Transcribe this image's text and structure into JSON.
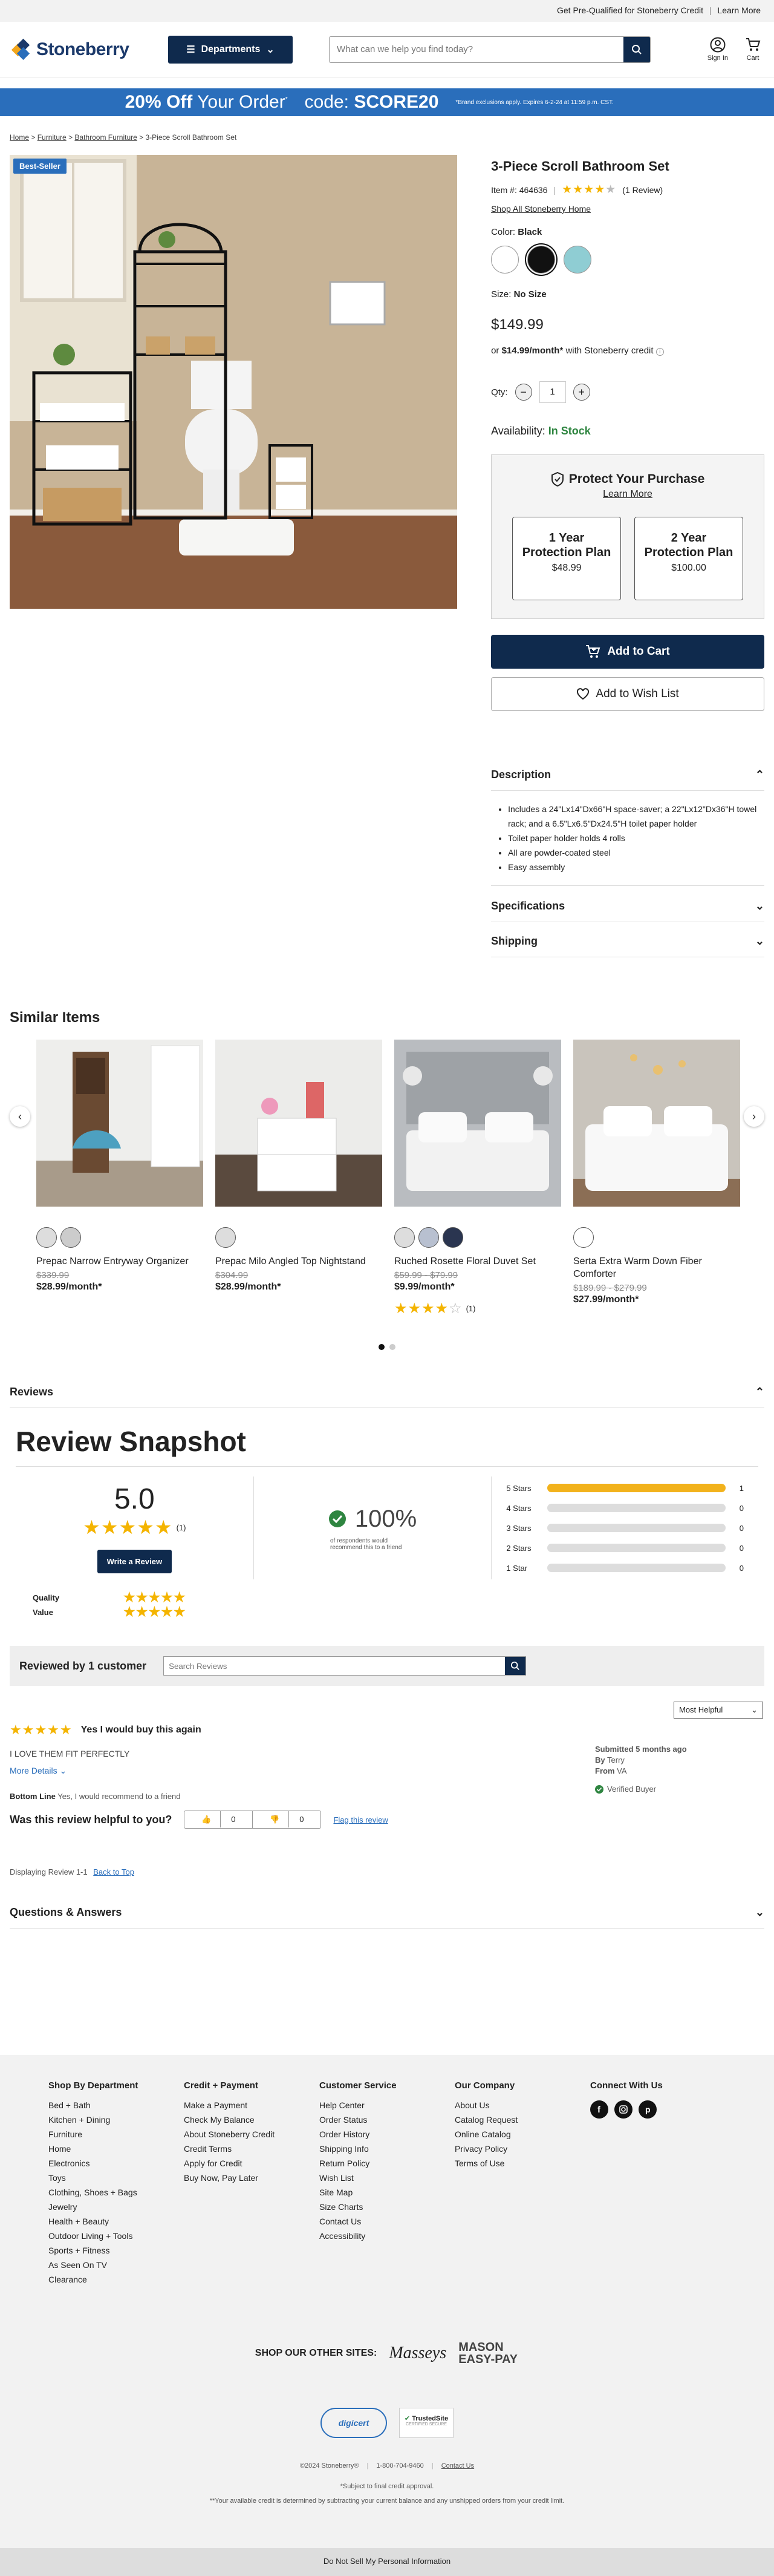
{
  "topbar": {
    "prequal": "Get Pre-Qualified for Stoneberry Credit",
    "sep": "|",
    "learn_more": "Learn More"
  },
  "header": {
    "logo_text": "Stoneberry",
    "departments_label": "Departments",
    "search_placeholder": "What can we help you find today?",
    "signin_label": "Sign In",
    "cart_label": "Cart"
  },
  "promo": {
    "headline_strong": "20% Off",
    "headline_rest": "Your Order",
    "code_label": "code:",
    "code": "SCORE20",
    "fine_print": "*Brand exclusions apply. Expires 6-2-24 at 11:59 p.m. CST."
  },
  "breadcrumb": [
    "Home",
    "Furniture",
    "Bathroom Furniture",
    "3-Piece Scroll Bathroom Set"
  ],
  "product": {
    "badge": "Best-Seller",
    "title": "3-Piece Scroll Bathroom Set",
    "item_label": "Item #: 464636",
    "rating": 4,
    "review_count": "(1 Review)",
    "shop_all": "Shop All Stoneberry Home",
    "color_label": "Color:",
    "color_value": "Black",
    "swatches": [
      {
        "name": "White",
        "hex": "#ffffff"
      },
      {
        "name": "Black",
        "hex": "#111111"
      },
      {
        "name": "Aqua",
        "hex": "#8fcdd3"
      }
    ],
    "size_label": "Size:",
    "size_value": "No Size",
    "price": "$149.99",
    "credit_prefix": "or",
    "credit_monthly": "$14.99/month*",
    "credit_suffix": "with Stoneberry credit",
    "qty_label": "Qty:",
    "qty_value": "1",
    "availability_label": "Availability:",
    "availability_value": "In Stock"
  },
  "protect": {
    "title": "Protect Your Purchase",
    "learn_more": "Learn More",
    "plans": [
      {
        "name": "1 Year Protection Plan",
        "price": "$48.99"
      },
      {
        "name": "2 Year Protection Plan",
        "price": "$100.00"
      }
    ]
  },
  "actions": {
    "add_to_cart": "Add to Cart",
    "add_to_wishlist": "Add to Wish List"
  },
  "description": {
    "title": "Description",
    "bullets": [
      "Includes a 24\"Lx14\"Dx66\"H space-saver; a 22\"Lx12\"Dx36\"H towel rack; and a 6.5\"Lx6.5\"Dx24.5\"H toilet paper holder",
      "Toilet paper holder holds 4 rolls",
      "All are powder-coated steel",
      "Easy assembly"
    ]
  },
  "specifications_title": "Specifications",
  "shipping_title": "Shipping",
  "similar": {
    "title": "Similar Items",
    "items": [
      {
        "name": "Prepac Narrow Entryway Organizer",
        "was": "$339.99",
        "month": "$28.99/month*"
      },
      {
        "name": "Prepac Milo Angled Top Nightstand",
        "was": "$304.99",
        "month": "$28.99/month*"
      },
      {
        "name": "Ruched Rosette Floral Duvet Set",
        "was": "$59.99 - $79.99",
        "month": "$9.99/month*",
        "rating_count": "(1)"
      },
      {
        "name": "Serta Extra Warm Down Fiber Comforter",
        "was": "$189.99 - $279.99",
        "month": "$27.99/month*"
      }
    ]
  },
  "reviews": {
    "section_title": "Reviews",
    "snapshot_title": "Review Snapshot",
    "average": "5.0",
    "count": "(1)",
    "write_label": "Write a Review",
    "recommend_pct": "100%",
    "recommend_text": "of respondents would recommend this to a friend",
    "distribution": [
      {
        "label": "5 Stars",
        "count": 1,
        "pct": 1
      },
      {
        "label": "4 Stars",
        "count": 0,
        "pct": 0
      },
      {
        "label": "3 Stars",
        "count": 0,
        "pct": 0
      },
      {
        "label": "2 Stars",
        "count": 0,
        "pct": 0
      },
      {
        "label": "1 Star",
        "count": 0,
        "pct": 0
      }
    ],
    "quality_label": "Quality",
    "value_label": "Value",
    "reviewed_by": "Reviewed by 1 customer",
    "search_placeholder": "Search Reviews",
    "sort": "Most Helpful",
    "item": {
      "headline": "Yes I would buy this again",
      "body": "I LOVE THEM FIT PERFECTLY",
      "more": "More Details",
      "bottom_line_label": "Bottom Line",
      "bottom_line": "Yes, I would recommend to a friend",
      "submitted": "Submitted 5 months ago",
      "by_label": "By",
      "by": "Terry",
      "from_label": "From",
      "from": "VA",
      "verified": "Verified Buyer"
    },
    "helpful_q": "Was this review helpful to you?",
    "yes_count": "0",
    "no_count": "0",
    "flag": "Flag this review",
    "displaying": "Displaying Review 1-1",
    "back_to_top": "Back to Top"
  },
  "qa_title": "Questions & Answers",
  "footer": {
    "columns": [
      {
        "title": "Shop By Department",
        "links": [
          "Bed + Bath",
          "Kitchen + Dining",
          "Furniture",
          "Home",
          "Electronics",
          "Toys",
          "Clothing, Shoes + Bags",
          "Jewelry",
          "Health + Beauty",
          "Outdoor Living + Tools",
          "Sports + Fitness",
          "As Seen On TV",
          "Clearance"
        ]
      },
      {
        "title": "Credit + Payment",
        "links": [
          "Make a Payment",
          "Check My Balance",
          "About Stoneberry Credit",
          "Credit Terms",
          "Apply for Credit",
          "Buy Now, Pay Later"
        ]
      },
      {
        "title": "Customer Service",
        "links": [
          "Help Center",
          "Order Status",
          "Order History",
          "Shipping Info",
          "Return Policy",
          "Wish List",
          "Site Map",
          "Size Charts",
          "Contact Us",
          "Accessibility"
        ]
      },
      {
        "title": "Our Company",
        "links": [
          "About Us",
          "Catalog Request",
          "Online Catalog",
          "Privacy Policy",
          "Terms of Use"
        ]
      }
    ],
    "connect_title": "Connect With Us",
    "other_sites_label": "SHOP OUR OTHER SITES:",
    "masseys": "Masseys",
    "mason": "MASON EASY-PAY",
    "digicert": "digicert",
    "trustedsite": "TrustedSite",
    "trustedsite_sub": "CERTIFIED SECURE",
    "copyright": "©2024 Stoneberry®",
    "phone": "1-800-704-9460",
    "contact": "Contact Us",
    "note1": "*Subject to final credit approval.",
    "note2": "**Your available credit is determined by subtracting your current balance and any unshipped orders from your credit limit.",
    "do_not_sell": "Do Not Sell My Personal Information"
  },
  "colors": {
    "navy": "#0f2a4d",
    "promo_blue": "#2a6ebb",
    "star": "#f4b400",
    "instock": "#2e8540"
  }
}
